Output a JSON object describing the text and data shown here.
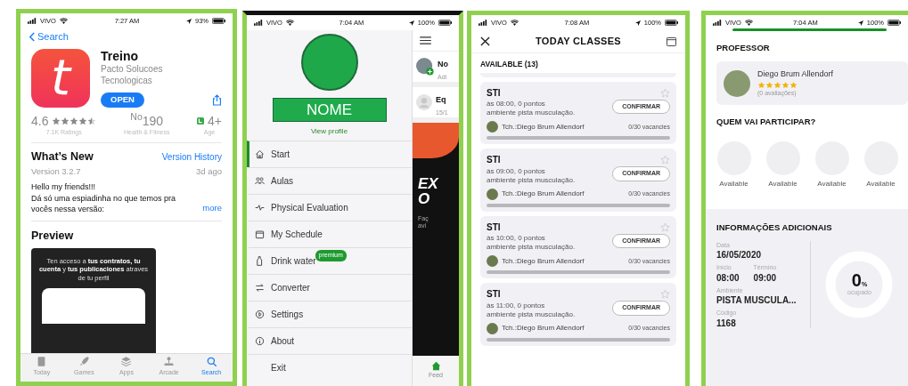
{
  "app_store": {
    "status_bar": {
      "carrier": "VIVO",
      "time": "7:27 AM",
      "battery": "93%"
    },
    "back": "Search",
    "app": {
      "logo_letter": "t",
      "name": "Treino",
      "developer": "Pacto Solucoes Tecnologicas",
      "button": "OPEN"
    },
    "stats": [
      {
        "kind": "rating",
        "value": "4.6",
        "stars": 4.5,
        "caption": "7.1K Ratings"
      },
      {
        "kind": "rank",
        "value": "$^{No}$190",
        "caption": "Health & Fitness"
      },
      {
        "kind": "age",
        "value": "4+",
        "caption": "Age"
      }
    ],
    "whats_new": {
      "title": "What’s New",
      "link": "Version History",
      "version": "Version 3.2.7",
      "date": "3d ago",
      "notes": [
        "Hello my friends!!!",
        "Dá só uma espiadinha no que temos pra vocês nessa versão:"
      ],
      "more": "more"
    },
    "preview": {
      "title": "Preview",
      "caption": "Ten acceso a **tus contratos, tu cuenta** y **tus publicaciones** atraves de tu perfil"
    },
    "tabs": [
      {
        "label": "Today",
        "selected": false
      },
      {
        "label": "Games",
        "selected": false
      },
      {
        "label": "Apps",
        "selected": false
      },
      {
        "label": "Arcade",
        "selected": false
      },
      {
        "label": "Search",
        "selected": true
      }
    ]
  },
  "side_menu": {
    "status_bar": {
      "carrier": "VIVO",
      "time": "7:04 AM",
      "battery": "100%"
    },
    "profile": {
      "name": "NOME",
      "link": "View profile"
    },
    "items": [
      {
        "label": "Start",
        "selected": true
      },
      {
        "label": "Aulas",
        "selected": false
      },
      {
        "label": "Physical Evaluation",
        "selected": false
      },
      {
        "label": "My Schedule",
        "selected": false
      },
      {
        "label": "Drink water",
        "selected": false,
        "badge": "premium"
      },
      {
        "label": "Converter",
        "selected": false
      },
      {
        "label": "Settings",
        "selected": false
      },
      {
        "label": "About",
        "selected": false
      },
      {
        "label": "Exit",
        "selected": false
      }
    ],
    "feed_peek": {
      "posts": [
        {
          "title": "No",
          "subtitle": "Adi"
        },
        {
          "title": "Eq",
          "subtitle": "15/1"
        }
      ],
      "banner": {
        "headline": [
          "EX",
          "O"
        ],
        "caption": [
          "Faç",
          "avi"
        ]
      },
      "tab": "Feed"
    }
  },
  "today_classes": {
    "status_bar": {
      "carrier": "VIVO",
      "time": "7:08 AM",
      "battery": "100%"
    },
    "title": "TODAY CLASSES",
    "section": "AVAILABLE (13)",
    "classes": [
      {
        "name": "STI",
        "time": "às 08:00, 0 pontos",
        "place": "ambiente pista musculação.",
        "teacher": "Tch.:Diego Brum Allendorf",
        "vacancies": "0/30 vacancies",
        "button": "CONFIRMAR",
        "favorite": false,
        "level": 0
      },
      {
        "name": "STI",
        "time": "às 09:00, 0 pontos",
        "place": "ambiente pista musculação.",
        "teacher": "Tch.:Diego Brum Allendorf",
        "vacancies": "0/30 vacancies",
        "button": "CONFIRMAR",
        "favorite": false,
        "level": 0
      },
      {
        "name": "STI",
        "time": "às 10:00, 0 pontos",
        "place": "ambiente pista musculação.",
        "teacher": "Tch.:Diego Brum Allendorf",
        "vacancies": "0/30 vacancies",
        "button": "CONFIRMAR",
        "favorite": false,
        "level": 0
      },
      {
        "name": "STI",
        "time": "às 11:00, 0 pontos",
        "place": "ambiente pista musculação.",
        "teacher": "Tch.:Diego Brum Allendorf",
        "vacancies": "0/30 vacancies",
        "button": "CONFIRMAR",
        "favorite": false,
        "level": 0
      }
    ]
  },
  "class_detail": {
    "status_bar": {
      "carrier": "VIVO",
      "time": "7:04 AM",
      "battery": "100%"
    },
    "professor": {
      "heading": "PROFESSOR",
      "name": "Diego Brum Allendorf",
      "stars": 5,
      "reviews": "(0 avaliações)"
    },
    "participants": {
      "heading": "QUEM VAI PARTICIPAR?",
      "slots": [
        "Available",
        "Available",
        "Available",
        "Available"
      ]
    },
    "info": {
      "heading": "INFORMAÇÕES ADICIONAIS",
      "field_rows": [
        [
          {
            "label": "Data",
            "value": "16/05/2020"
          }
        ],
        [
          {
            "label": "Início",
            "value": "08:00"
          },
          {
            "label": "Término",
            "value": "09:00"
          }
        ],
        [
          {
            "label": "Ambiente",
            "value": "PISTA MUSCULA..."
          }
        ],
        [
          {
            "label": "Código",
            "value": "1168"
          }
        ]
      ],
      "occupancy": {
        "value": "0",
        "unit": "%",
        "caption": "ocupado",
        "level": 0
      }
    }
  }
}
